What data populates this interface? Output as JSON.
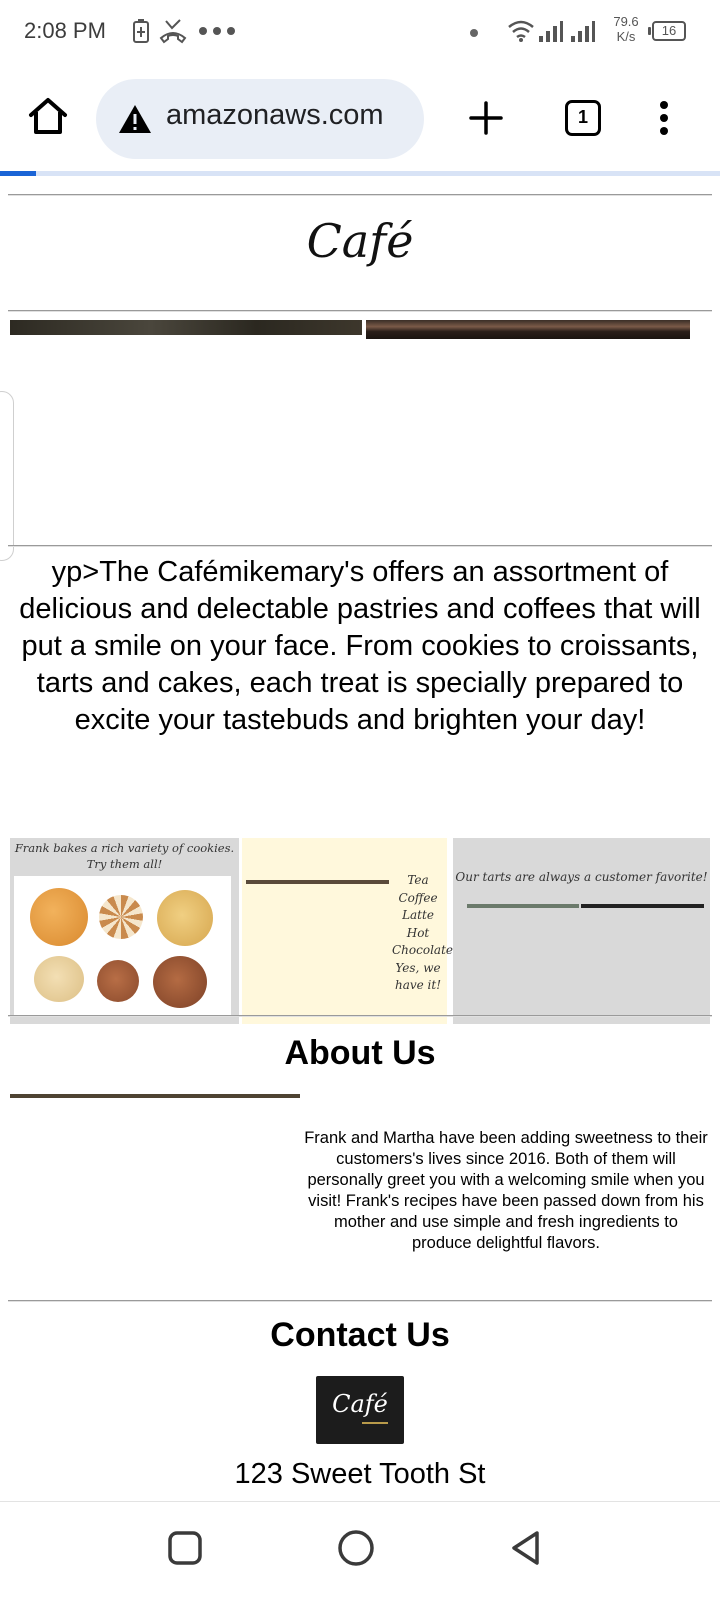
{
  "status_bar": {
    "time": "2:08 PM",
    "net_speed_value": "79.6",
    "net_speed_unit": "K/s",
    "battery": "16",
    "icons": [
      "battery-charging-icon",
      "missed-call-icon",
      "more-dots-icon",
      "dot-icon",
      "wifi-icon",
      "signal-icon",
      "signal-icon"
    ]
  },
  "browser": {
    "url": "amazonaws.com",
    "tab_count": "1",
    "load_progress": 0.05,
    "colors": {
      "url_bar": "#e9eef6",
      "progress": "#1a64d6"
    }
  },
  "page": {
    "logo": "Café",
    "intro": "yp>The Cafémikemary's offers an assortment of delicious and delectable pastries and coffees that will put a smile on your face. From cookies to croissants, tarts and cakes, each treat is specially prepared to excite your tastebuds and brighten your day!",
    "panels": {
      "cookies_caption": "Frank bakes a rich variety of cookies. Try them all!",
      "menu": [
        "Tea",
        "Coffee",
        "Latte",
        "Hot",
        "Chocolate",
        "Yes, we",
        "have it!"
      ],
      "tarts_caption": "Our tarts are always a customer favorite!"
    },
    "about": {
      "heading": "About Us",
      "text": "Frank and Martha have been adding sweetness to their customers's lives since 2016. Both of them will personally greet you with a welcoming smile when you visit! Frank's recipes have been passed down from his mother and use simple and fresh ingredients to produce delightful flavors."
    },
    "contact": {
      "heading": "Contact Us",
      "logo_text": "Café",
      "address": "123 Sweet Tooth St"
    }
  }
}
